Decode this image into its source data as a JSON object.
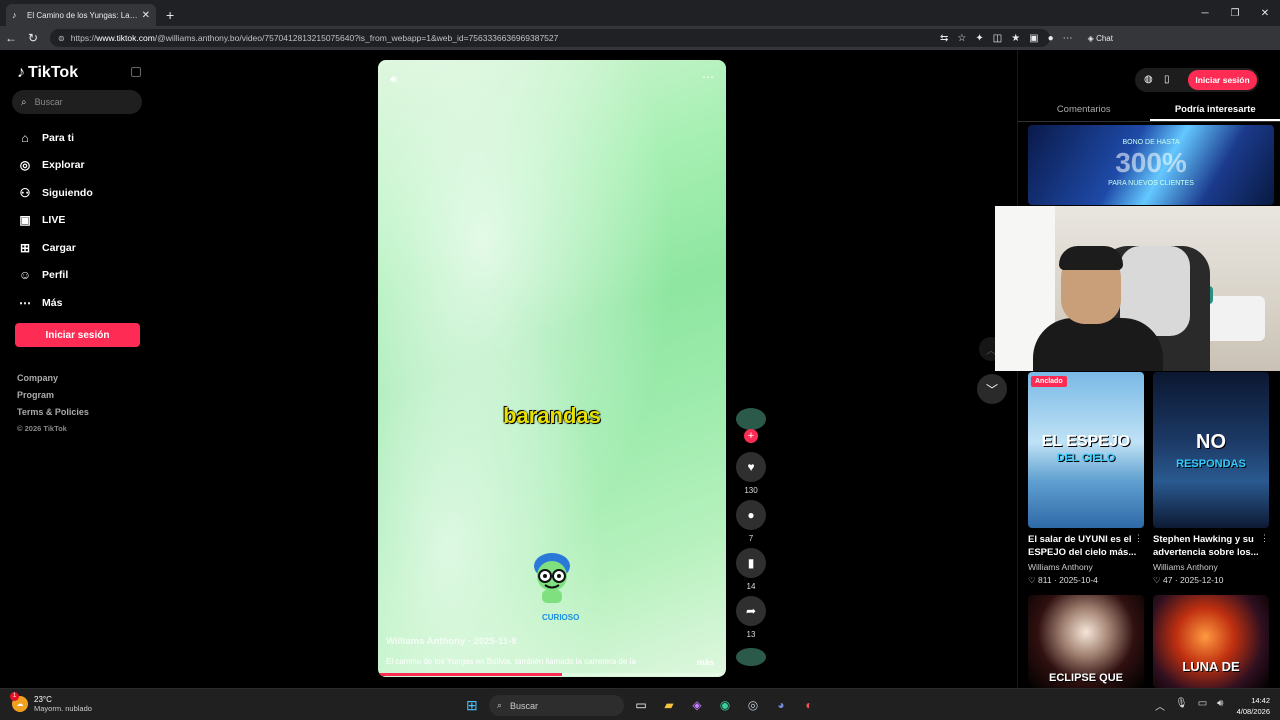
{
  "browser": {
    "tab_title": "El Camino de los Yungas: La Carretera",
    "url_prefix": "https://",
    "url_host": "www.tiktok.com",
    "url_path": "/@williams.anthony.bo/video/7570412813215075640?is_from_webapp=1&web_id=7563336636969387527",
    "chat_label": "Chat"
  },
  "sidebar": {
    "logo": "TikTok",
    "search_placeholder": "Buscar",
    "items": [
      {
        "label": "Para ti",
        "icon": "home-icon"
      },
      {
        "label": "Explorar",
        "icon": "compass-icon"
      },
      {
        "label": "Siguiendo",
        "icon": "following-icon"
      },
      {
        "label": "LIVE",
        "icon": "live-icon"
      },
      {
        "label": "Cargar",
        "icon": "upload-icon"
      },
      {
        "label": "Perfil",
        "icon": "profile-icon"
      },
      {
        "label": "Más",
        "icon": "more-icon"
      }
    ],
    "login_label": "Iniciar sesión",
    "footer": [
      "Company",
      "Program",
      "Terms & Policies",
      "© 2026 TikTok"
    ]
  },
  "video": {
    "caption_overlay": "barandas",
    "mascot_label": "CURIOSO",
    "author_line": "Williams Anthony · 2025-11-8",
    "description": "El camino de los Yungas en Bolivia, también llamado la carretera de la",
    "more_label": "más",
    "progress": 0.53
  },
  "actions": {
    "likes": "130",
    "comments": "7",
    "saves": "14",
    "shares": "13"
  },
  "right_panel": {
    "login_label": "Iniciar sesión",
    "tabs": [
      "Comentarios",
      "Podría interesarte"
    ],
    "active_tab": 1,
    "banner_line1": "BONO DE HASTA",
    "banner_big": "300%",
    "banner_line2": "PARA NUEVOS CLIENTES",
    "cards": [
      {
        "thumb_text": "EL ESPEJO",
        "thumb_sub": "DEL CIELO",
        "pinned": "Anclado",
        "title": "El salar de UYUNI es el ESPEJO del cielo más...",
        "author": "Williams Anthony",
        "likes": "811",
        "date": "2025-10-4"
      },
      {
        "thumb_text": "NO",
        "thumb_sub": "RESPONDAS",
        "title": "Stephen Hawking y su advertencia sobre los...",
        "author": "Williams Anthony",
        "likes": "47",
        "date": "2025-12-10"
      },
      {
        "thumb_text": "ECLIPSE QUE",
        "thumb_sub": ""
      },
      {
        "thumb_text": "LUNA DE",
        "thumb_sub": ""
      }
    ]
  },
  "taskbar": {
    "weather_temp": "23°C",
    "weather_desc": "Mayorm. nublado",
    "weather_badge": "1",
    "search_placeholder": "Buscar",
    "time": "14:42",
    "date": "4/08/2026"
  },
  "colors": {
    "accent": "#fe2c55",
    "video_tint": "#a8f0b4"
  }
}
